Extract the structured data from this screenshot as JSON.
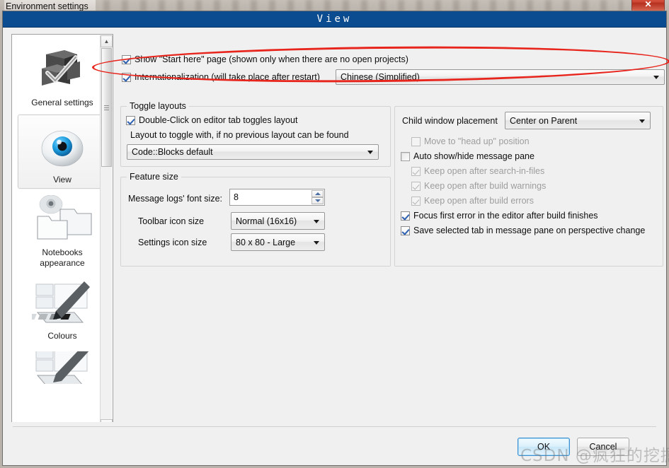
{
  "os": {
    "window_title": "Environment settings",
    "close_label": "✕"
  },
  "dialog": {
    "title": "View"
  },
  "sidebar": {
    "items": [
      {
        "label": "General settings",
        "icon": "boxes-check-icon",
        "selected": false
      },
      {
        "label": "View",
        "icon": "eye-icon",
        "selected": true
      },
      {
        "label": "Notebooks appearance",
        "icon": "folders-icon",
        "selected": false
      },
      {
        "label": "Colours",
        "icon": "palette-brush-icon",
        "selected": false
      },
      {
        "label": "",
        "icon": "palette-brush-icon",
        "selected": false
      }
    ],
    "scroll_up": "▲",
    "scroll_down": "▼"
  },
  "top_options": {
    "show_start_here": {
      "label": "Show \"Start here\" page (shown only when there are no open projects)",
      "checked": true
    },
    "internationalization": {
      "label": "Internationalization (will take place after restart)",
      "checked": true,
      "language_value": "Chinese (Simplified)"
    }
  },
  "toggle_layouts": {
    "title": "Toggle layouts",
    "double_click": {
      "label": "Double-Click on editor tab toggles layout",
      "checked": true
    },
    "hint": "Layout to toggle with, if no previous layout can be found",
    "layout_value": "Code::Blocks default"
  },
  "feature_size": {
    "title": "Feature size",
    "message_logs_font_label": "Message logs' font size:",
    "message_logs_font_value": "8",
    "toolbar_icon_label": "Toolbar icon size",
    "toolbar_icon_value": "Normal (16x16)",
    "settings_icon_label": "Settings icon size",
    "settings_icon_value": "80 x 80 - Large"
  },
  "right_panel": {
    "child_window_placement_label": "Child window placement",
    "child_window_placement_value": "Center on Parent",
    "options": [
      {
        "label": "Move to \"head up\" position",
        "checked": false,
        "disabled": true,
        "indent": 1
      },
      {
        "label": "Auto show/hide message pane",
        "checked": false,
        "disabled": false,
        "indent": 0
      },
      {
        "label": "Keep open after search-in-files",
        "checked": true,
        "disabled": true,
        "indent": 1
      },
      {
        "label": "Keep open after build warnings",
        "checked": true,
        "disabled": true,
        "indent": 1
      },
      {
        "label": "Keep open after build errors",
        "checked": true,
        "disabled": true,
        "indent": 1
      },
      {
        "label": "Focus first error in the editor after build finishes",
        "checked": true,
        "disabled": false,
        "indent": 0
      },
      {
        "label": "Save selected tab in message pane on perspective change",
        "checked": true,
        "disabled": false,
        "indent": 0
      }
    ]
  },
  "footer": {
    "ok_label": "OK",
    "cancel_label": "Cancel"
  },
  "watermark": {
    "text": "CSDN @疯狂的挖掘机"
  },
  "colors": {
    "header_blue": "#0b4b8f",
    "annotation_red": "#e8251c",
    "accent_check_blue": "#2b5fb0",
    "close_red": "#cf4a36"
  }
}
